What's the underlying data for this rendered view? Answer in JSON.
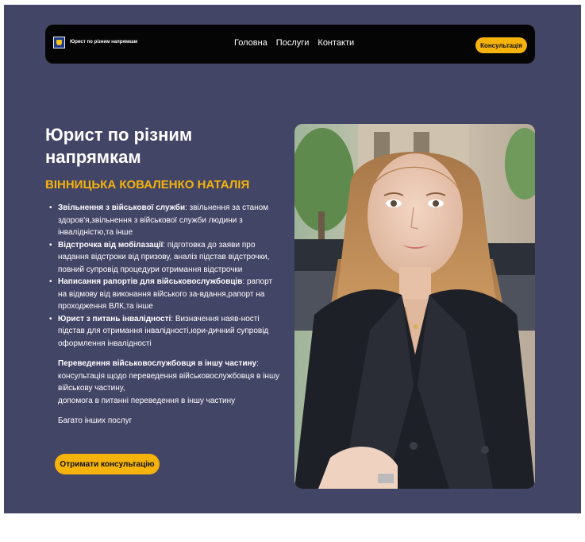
{
  "nav": {
    "brand": "Юрист по різним напрямкам",
    "links": [
      "Головна",
      "Послуги",
      "Контакти"
    ],
    "cta": "Консультація"
  },
  "hero": {
    "title": "Юрист по різним напрямкам",
    "name": "ВІННИЦЬКА КОВАЛЕНКО НАТАЛІЯ",
    "services": [
      {
        "title": "Звільнення з військової служби",
        "sep": ":",
        "text": " звільнення за станом здоров'я,звільнення з військової служби людини з інвалідністю,та інше"
      },
      {
        "title": "Відстрочка від мобілазації",
        "sep": ":",
        "text": " підготовка до заяви про надання відстроки від призову, аналіз підстав відстрочки, повний супровід процедури отримання відстрочки"
      },
      {
        "title": "Написання рапортів для військовослужбовців",
        "sep": ":",
        "text": " рапорт на відмову від виконання війського за-вдання,рапорт на проходження ВЛК,та інше"
      },
      {
        "title": "Юрист з питань інвалідності",
        "sep": ":",
        "text": " Визначення наяв-ності підстав для отримання інвалідності,юри-дичний супровід оформлення інвалідності"
      }
    ],
    "transfer": {
      "title": "Переведення військовослужбовця в іншу частину",
      "sep": ":",
      "line1": "консультація щодо переведення військовослужбовця в іншу військову частину,",
      "line2": "допомога в питанні переведення в іншу частину"
    },
    "more": "Багато інших послуг",
    "cta": "Отримати консультацію"
  },
  "colors": {
    "page_bg": "#434566",
    "accent": "#f5b30b",
    "nav_bg": "#050505"
  },
  "icons": {
    "logo": "shield-logo-icon"
  }
}
